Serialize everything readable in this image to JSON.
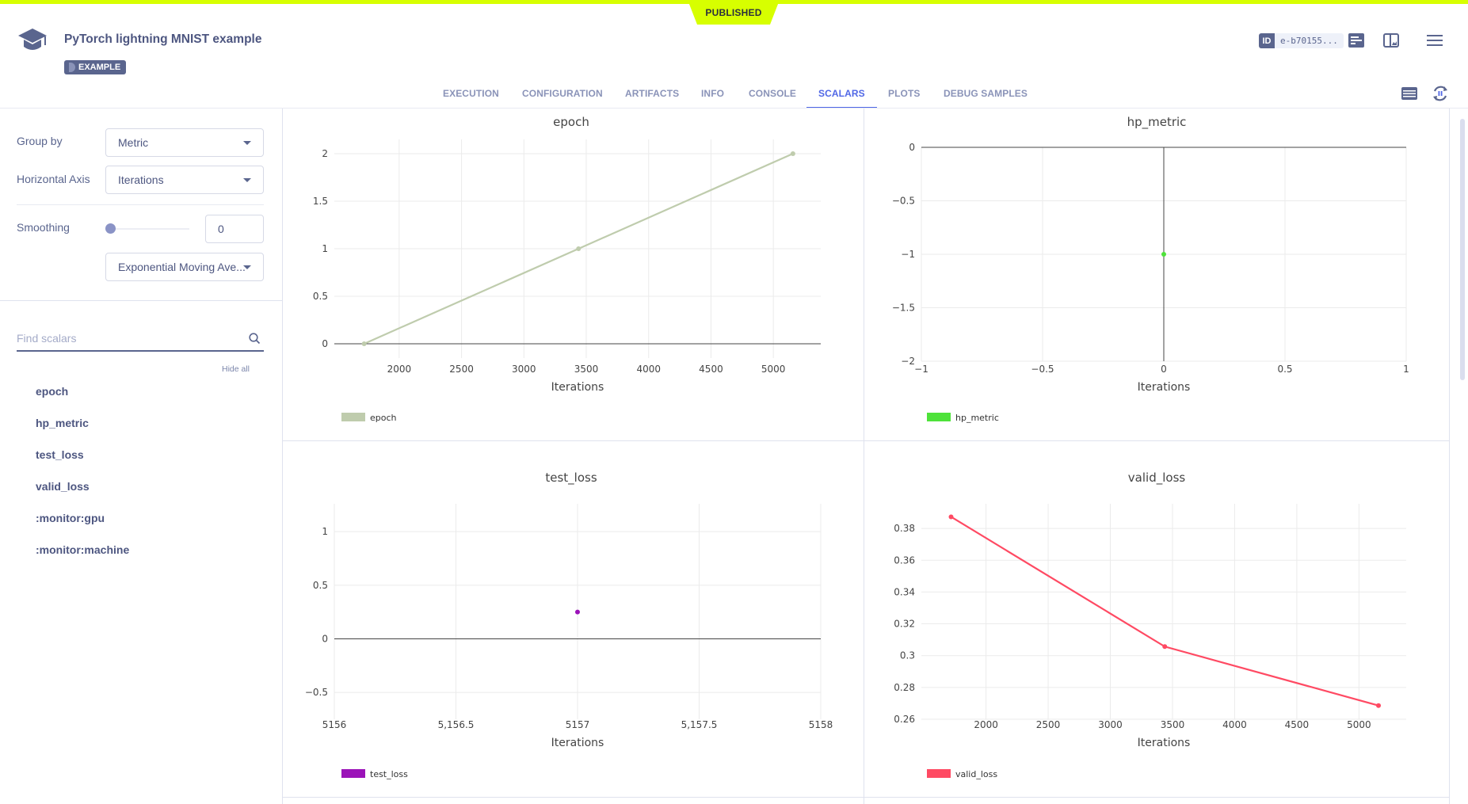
{
  "header": {
    "status_banner": "PUBLISHED",
    "title": "PyTorch lightning MNIST example",
    "badge": "EXAMPLE",
    "id_label": "ID",
    "id_value": "e-b70155...",
    "icons": [
      "info-panel-icon",
      "layout-toggle-icon",
      "menu-icon"
    ]
  },
  "tabs": [
    {
      "label": "EXECUTION",
      "active": false
    },
    {
      "label": "CONFIGURATION",
      "active": false
    },
    {
      "label": "ARTIFACTS",
      "active": false
    },
    {
      "label": "INFO",
      "active": false
    },
    {
      "label": "CONSOLE",
      "active": false
    },
    {
      "label": "SCALARS",
      "active": true
    },
    {
      "label": "PLOTS",
      "active": false
    },
    {
      "label": "DEBUG SAMPLES",
      "active": false
    }
  ],
  "toolbar_icons": [
    "list-view-icon",
    "auto-refresh-pause-icon"
  ],
  "sidebar": {
    "group_by_label": "Group by",
    "group_by_value": "Metric",
    "horizontal_axis_label": "Horizontal Axis",
    "horizontal_axis_value": "Iterations",
    "smoothing_label": "Smoothing",
    "smoothing_value": "0",
    "smoothing_fraction": 0,
    "smoothing_method": "Exponential Moving Ave...",
    "search_placeholder": "Find scalars",
    "search_value": "",
    "hide_all": "Hide all",
    "metrics": [
      "epoch",
      "hp_metric",
      "test_loss",
      "valid_loss",
      ":monitor:gpu",
      ":monitor:machine"
    ]
  },
  "chart_data": [
    {
      "type": "line",
      "title": "epoch",
      "xlabel": "Iterations",
      "ylabel": "",
      "x": [
        1719,
        3438,
        5157
      ],
      "series": [
        {
          "name": "epoch",
          "color": "#bfccad",
          "values": [
            0,
            1,
            2
          ]
        }
      ],
      "xlim": [
        1480,
        5380
      ],
      "ylim": [
        -0.15,
        2.15
      ],
      "xticks": [
        2000,
        2500,
        3000,
        3500,
        4000,
        4500,
        5000
      ],
      "xtick_labels": [
        "2000",
        "2500",
        "3000",
        "3500",
        "4000",
        "4500",
        "5000"
      ],
      "yticks": [
        0,
        0.5,
        1,
        1.5,
        2
      ],
      "ytick_labels": [
        "0",
        "0.5",
        "1",
        "1.5",
        "2"
      ],
      "grid": true,
      "legend": "bottom-left"
    },
    {
      "type": "scatter",
      "title": "hp_metric",
      "xlabel": "Iterations",
      "ylabel": "",
      "x": [
        0
      ],
      "series": [
        {
          "name": "hp_metric",
          "color": "#4ee23a",
          "values": [
            -1
          ]
        }
      ],
      "xlim": [
        -1,
        1
      ],
      "ylim": [
        -2,
        0
      ],
      "xticks": [
        -1,
        -0.5,
        0,
        0.5,
        1
      ],
      "xtick_labels": [
        "−1",
        "−0.5",
        "0",
        "0.5",
        "1"
      ],
      "yticks": [
        0,
        -0.5,
        -1,
        -1.5,
        -2
      ],
      "ytick_labels": [
        "0",
        "−0.5",
        "−1",
        "−1.5",
        "−2"
      ],
      "grid": true,
      "legend": "bottom-left"
    },
    {
      "type": "scatter",
      "title": "test_loss",
      "xlabel": "Iterations",
      "ylabel": "",
      "x": [
        5157
      ],
      "series": [
        {
          "name": "test_loss",
          "color": "#9b13b8",
          "values": [
            0.25
          ]
        }
      ],
      "xlim": [
        5156,
        5158
      ],
      "ylim": [
        -0.75,
        1.26
      ],
      "xticks": [
        5156,
        5156.5,
        5157,
        5157.5,
        5158
      ],
      "xtick_labels": [
        "5156",
        "5,156.5",
        "5157",
        "5,157.5",
        "5158"
      ],
      "yticks": [
        -0.5,
        0,
        0.5,
        1
      ],
      "ytick_labels": [
        "−0.5",
        "0",
        "0.5",
        "1"
      ],
      "grid": true,
      "legend": "bottom-left"
    },
    {
      "type": "line",
      "title": "valid_loss",
      "xlabel": "Iterations",
      "ylabel": "",
      "x": [
        1719,
        3438,
        5157
      ],
      "series": [
        {
          "name": "valid_loss",
          "color": "#ff4a63",
          "values": [
            0.3873,
            0.3057,
            0.2686
          ]
        }
      ],
      "xlim": [
        1480,
        5380
      ],
      "ylim": [
        0.26,
        0.3955
      ],
      "xticks": [
        2000,
        2500,
        3000,
        3500,
        4000,
        4500,
        5000
      ],
      "xtick_labels": [
        "2000",
        "2500",
        "3000",
        "3500",
        "4000",
        "4500",
        "5000"
      ],
      "yticks": [
        0.26,
        0.28,
        0.3,
        0.32,
        0.34,
        0.36,
        0.38
      ],
      "ytick_labels": [
        "0.26",
        "0.28",
        "0.3",
        "0.32",
        "0.34",
        "0.36",
        "0.38"
      ],
      "grid": true,
      "legend": "bottom-left"
    }
  ]
}
